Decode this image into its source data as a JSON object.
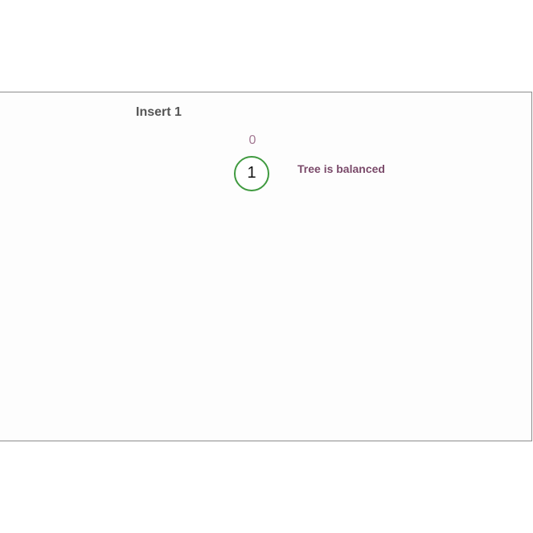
{
  "operation": {
    "title": "Insert 1"
  },
  "tree": {
    "root": {
      "value": "1",
      "balance_factor": "0",
      "border_color": "#3f9a3f"
    }
  },
  "status": {
    "message": "Tree is balanced"
  },
  "colors": {
    "title": "#555555",
    "balance_factor": "#a47a94",
    "status": "#7a4a6a",
    "frame_border": "#8c8c8c"
  }
}
